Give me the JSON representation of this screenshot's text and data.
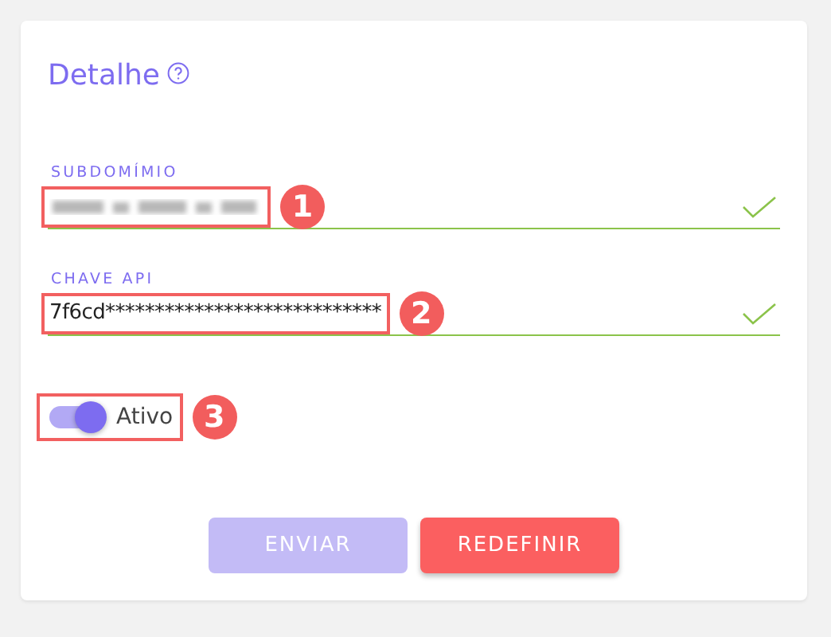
{
  "card": {
    "title": "Detalhe"
  },
  "fields": [
    {
      "label": "SUBDOMÍMIO",
      "kind": "blurred",
      "valid": true,
      "callout": "1"
    },
    {
      "label": "CHAVE API",
      "kind": "text",
      "value": "7f6cd****************************",
      "valid": true,
      "callout": "2"
    }
  ],
  "toggle": {
    "label": "Ativo",
    "on": true,
    "callout": "3"
  },
  "buttons": [
    {
      "label": "ENVIAR",
      "kind": "primary",
      "disabled": true
    },
    {
      "label": "REDEFINIR",
      "kind": "danger",
      "disabled": false
    }
  ]
}
